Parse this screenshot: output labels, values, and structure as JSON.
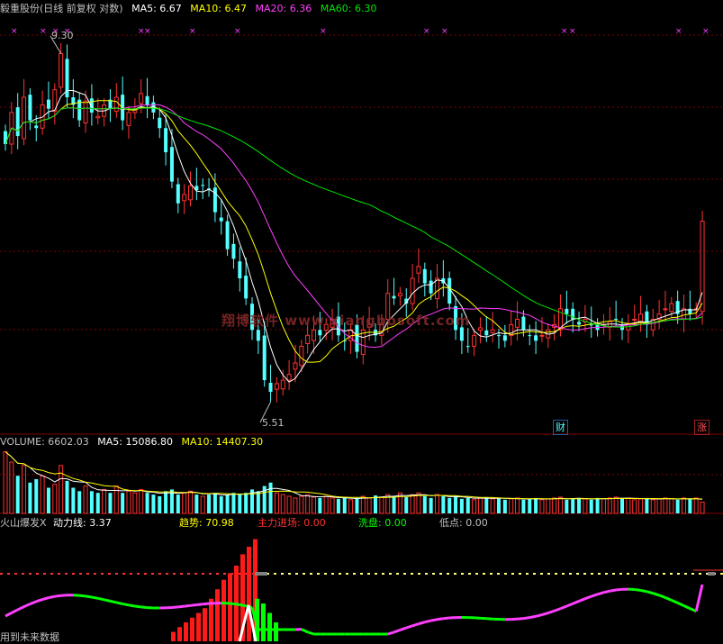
{
  "price_header": {
    "title": "毅重股份(日线 前复权 对数)",
    "ma5_label": "MA5: 6.67",
    "ma10_label": "MA10: 6.47",
    "ma20_label": "MA20: 6.36",
    "ma60_label": "MA60: 6.30"
  },
  "high_label": "9.30",
  "low_label": "5.51",
  "watermark": "翔博软件 www.xiangbosoft.com",
  "badge_cai": "财",
  "badge_zhang": "涨",
  "volume_header": {
    "volume_label": "VOLUME: 6602.03",
    "ma5_label": "MA5: 15086.80",
    "ma10_label": "MA10: 14407.30"
  },
  "indicator_header": {
    "name": "火山爆发X",
    "power_label": "动力线: 3.37",
    "trend_label": "趋势: 70.98",
    "main_force_label": "主力进场: 0.00",
    "wash_label": "洗盘: 0.00",
    "low_point_label": "低点: 0.00"
  },
  "bottom_note": "用到未来数据",
  "colors": {
    "up": "#ff3232",
    "down": "#54ffff",
    "ma5": "#ffffff",
    "ma10": "#ffff00",
    "ma20": "#ff40ff",
    "ma60": "#00e600",
    "grid": "#800000",
    "text": "#c0c0c0"
  },
  "chart_data": [
    {
      "type": "candlestick",
      "title": "毅重股份(日线 前复权 对数)",
      "y_high_marked": 9.3,
      "y_low_marked": 5.51,
      "ma_last": {
        "MA5": 6.67,
        "MA10": 6.47,
        "MA20": 6.36,
        "MA60": 6.3
      },
      "closes": [
        8.1,
        8.5,
        8.2,
        8.7,
        8.4,
        8.3,
        8.6,
        8.55,
        8.8,
        9.3,
        8.7,
        8.6,
        8.4,
        8.65,
        8.5,
        8.45,
        8.6,
        8.55,
        8.7,
        8.4,
        8.5,
        8.55,
        8.75,
        8.6,
        8.5,
        8.3,
        8.0,
        7.65,
        7.4,
        7.5,
        7.6,
        7.55,
        7.6,
        7.55,
        7.3,
        7.2,
        6.9,
        6.8,
        6.6,
        6.4,
        6.1,
        6.0,
        5.65,
        5.55,
        5.62,
        5.65,
        5.7,
        5.8,
        5.95,
        6.05,
        6.1,
        6.05,
        6.15,
        6.2,
        6.05,
        6.0,
        6.1,
        5.9,
        6.1,
        6.15,
        6.05,
        6.15,
        6.45,
        6.4,
        6.45,
        6.35,
        6.6,
        6.72,
        6.55,
        6.45,
        6.6,
        6.55,
        6.35,
        6.1,
        6.0,
        5.95,
        6.05,
        6.12,
        6.05,
        6.1,
        6.05,
        6.0,
        6.15,
        6.2,
        6.1,
        6.05,
        6.0,
        6.05,
        6.1,
        6.15,
        6.3,
        6.25,
        6.2,
        6.15,
        6.2,
        6.15,
        6.1,
        6.15,
        6.18,
        6.2,
        6.1,
        6.15,
        6.2,
        6.25,
        6.15,
        6.2,
        6.25,
        6.3,
        6.35,
        6.25,
        6.3,
        6.25,
        6.3,
        7.2
      ]
    },
    {
      "type": "bar",
      "title": "VOLUME",
      "last": 6602.03,
      "ma5_last": 15086.8,
      "ma10_last": 14407.3,
      "values": [
        36000,
        30000,
        22000,
        28000,
        18000,
        20000,
        22000,
        15000,
        17000,
        28000,
        19000,
        15000,
        13000,
        16000,
        13000,
        12000,
        14000,
        12000,
        16000,
        12000,
        13000,
        12000,
        14000,
        12000,
        11000,
        10000,
        13000,
        14000,
        11000,
        12000,
        13000,
        11000,
        10000,
        11000,
        12000,
        10000,
        11000,
        12000,
        11000,
        12000,
        14000,
        13000,
        16000,
        18000,
        12000,
        11000,
        10000,
        9000,
        10000,
        11000,
        9500,
        9000,
        10000,
        9000,
        8500,
        9000,
        8000,
        9000,
        10000,
        9000,
        10500,
        9500,
        11000,
        10000,
        12000,
        9500,
        11000,
        12000,
        10000,
        9000,
        11000,
        10000,
        9000,
        10000,
        8500,
        9000,
        8000,
        9000,
        9500,
        8500,
        9000,
        8000,
        8500,
        9000,
        8000,
        8500,
        9000,
        8000,
        8500,
        9000,
        9500,
        8000,
        8500,
        9000,
        8500,
        8000,
        9000,
        8500,
        9000,
        9500,
        8500,
        9000,
        8000,
        8500,
        9000,
        8000,
        8500,
        9000,
        8500,
        8000,
        9000,
        8500,
        9000,
        6602
      ]
    },
    {
      "type": "bar",
      "title": "火山爆发X",
      "series": [
        {
          "name": "动力线",
          "last": 3.37
        },
        {
          "name": "趋势",
          "last": 70.98
        },
        {
          "name": "主力进场",
          "last": 0.0
        },
        {
          "name": "洗盘",
          "last": 0.0
        },
        {
          "name": "低点",
          "last": 0.0
        }
      ],
      "red_column_values": [
        10,
        15,
        20,
        25,
        30,
        35,
        45,
        55,
        65,
        72,
        80,
        92,
        100,
        108
      ]
    }
  ]
}
